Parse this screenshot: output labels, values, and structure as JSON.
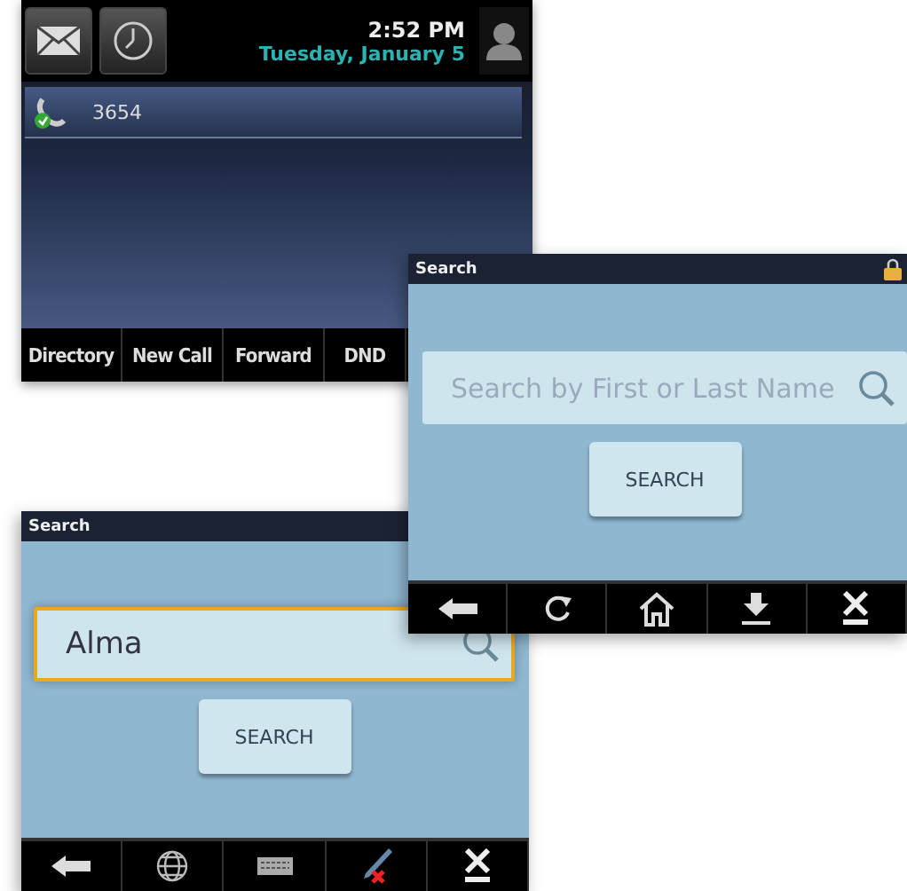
{
  "home": {
    "time": "2:52 PM",
    "date": "Tuesday, January 5",
    "line": {
      "number": "3654",
      "registered": true
    },
    "softkeys": [
      "Directory",
      "New Call",
      "Forward",
      "DND"
    ]
  },
  "search_screens": [
    {
      "title": "Search",
      "field": {
        "placeholder": "Search by First or Last Name",
        "focused": false
      },
      "button": "SEARCH",
      "kind": "navigation"
    },
    {
      "title": "Search",
      "field": {
        "value": "Alma",
        "focused": true
      },
      "button": "SEARCH",
      "kind": "input"
    }
  ]
}
